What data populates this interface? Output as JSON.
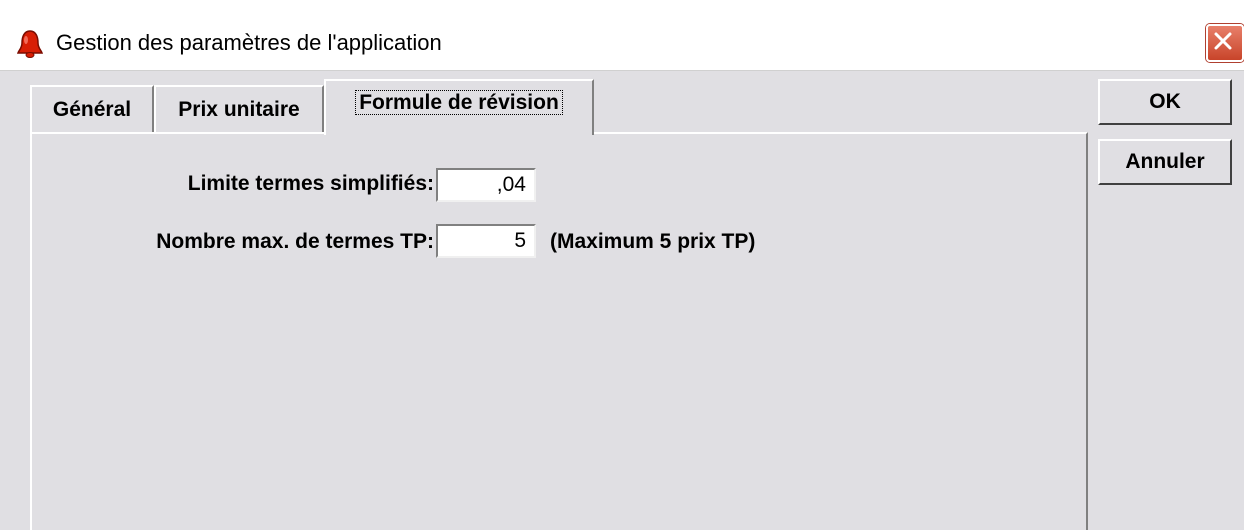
{
  "window": {
    "title": "Gestion des paramètres de l'application",
    "icon": "bell-icon",
    "close_icon": "close-icon"
  },
  "tabs": [
    {
      "label": "Général",
      "active": false
    },
    {
      "label": "Prix unitaire",
      "active": false
    },
    {
      "label": "Formule de révision",
      "active": true
    }
  ],
  "form": {
    "limite_label": "Limite termes simplifiés:",
    "limite_value": ",04",
    "nombre_label": "Nombre max. de termes TP:",
    "nombre_value": "5",
    "nombre_note": "(Maximum 5 prix TP)"
  },
  "buttons": {
    "ok": "OK",
    "cancel": "Annuler"
  },
  "colors": {
    "face": "#e0dfe3",
    "close": "#d2553a",
    "icon": "#d81e05"
  }
}
